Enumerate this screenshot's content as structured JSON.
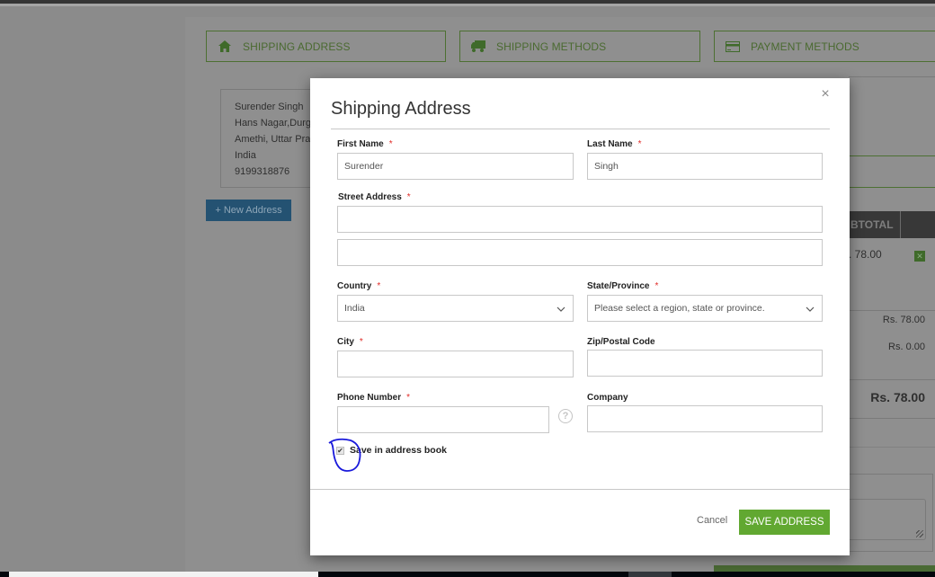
{
  "checkout_steps": [
    {
      "label": "SHIPPING ADDRESS",
      "icon": "home-icon"
    },
    {
      "label": "SHIPPING METHODS",
      "icon": "truck-icon"
    },
    {
      "label": "PAYMENT METHODS",
      "icon": "credit-card-icon"
    }
  ],
  "saved_address": {
    "lines": [
      "Surender Singh",
      "Hans Nagar,Durga",
      "Amethi, Uttar Prad",
      "India",
      "9199318876"
    ],
    "new_address_label": "+ New Address"
  },
  "order_summary": {
    "column_header": "BTOTAL",
    "item_subtotal": ". 78.00",
    "subtotal": "Rs. 78.00",
    "shipping": "Rs. 0.00",
    "total": "Rs. 78.00"
  },
  "modal": {
    "title": "Shipping Address",
    "close_label": "×",
    "fields": {
      "first_name": {
        "label": "First Name",
        "value": "Surender",
        "required": "*"
      },
      "last_name": {
        "label": "Last Name",
        "value": "Singh",
        "required": "*"
      },
      "street": {
        "label": "Street Address",
        "value_1": "",
        "value_2": "",
        "required": "*"
      },
      "country": {
        "label": "Country",
        "value": "India",
        "required": "*"
      },
      "state": {
        "label": "State/Province",
        "value": "Please select a region, state or province.",
        "required": "*"
      },
      "city": {
        "label": "City",
        "value": "",
        "required": "*"
      },
      "zip": {
        "label": "Zip/Postal Code",
        "value": ""
      },
      "phone": {
        "label": "Phone Number",
        "value": "",
        "required": "*",
        "help": "?"
      },
      "company": {
        "label": "Company",
        "value": ""
      }
    },
    "save_in_book": {
      "label": "Save in address book",
      "checked": true,
      "check_glyph": "✔"
    },
    "cancel_label": "Cancel",
    "save_label": "SAVE ADDRESS"
  },
  "colors": {
    "accent_green": "#61a831",
    "required": "#e02b27",
    "annotation_blue": "#1a1adb"
  }
}
